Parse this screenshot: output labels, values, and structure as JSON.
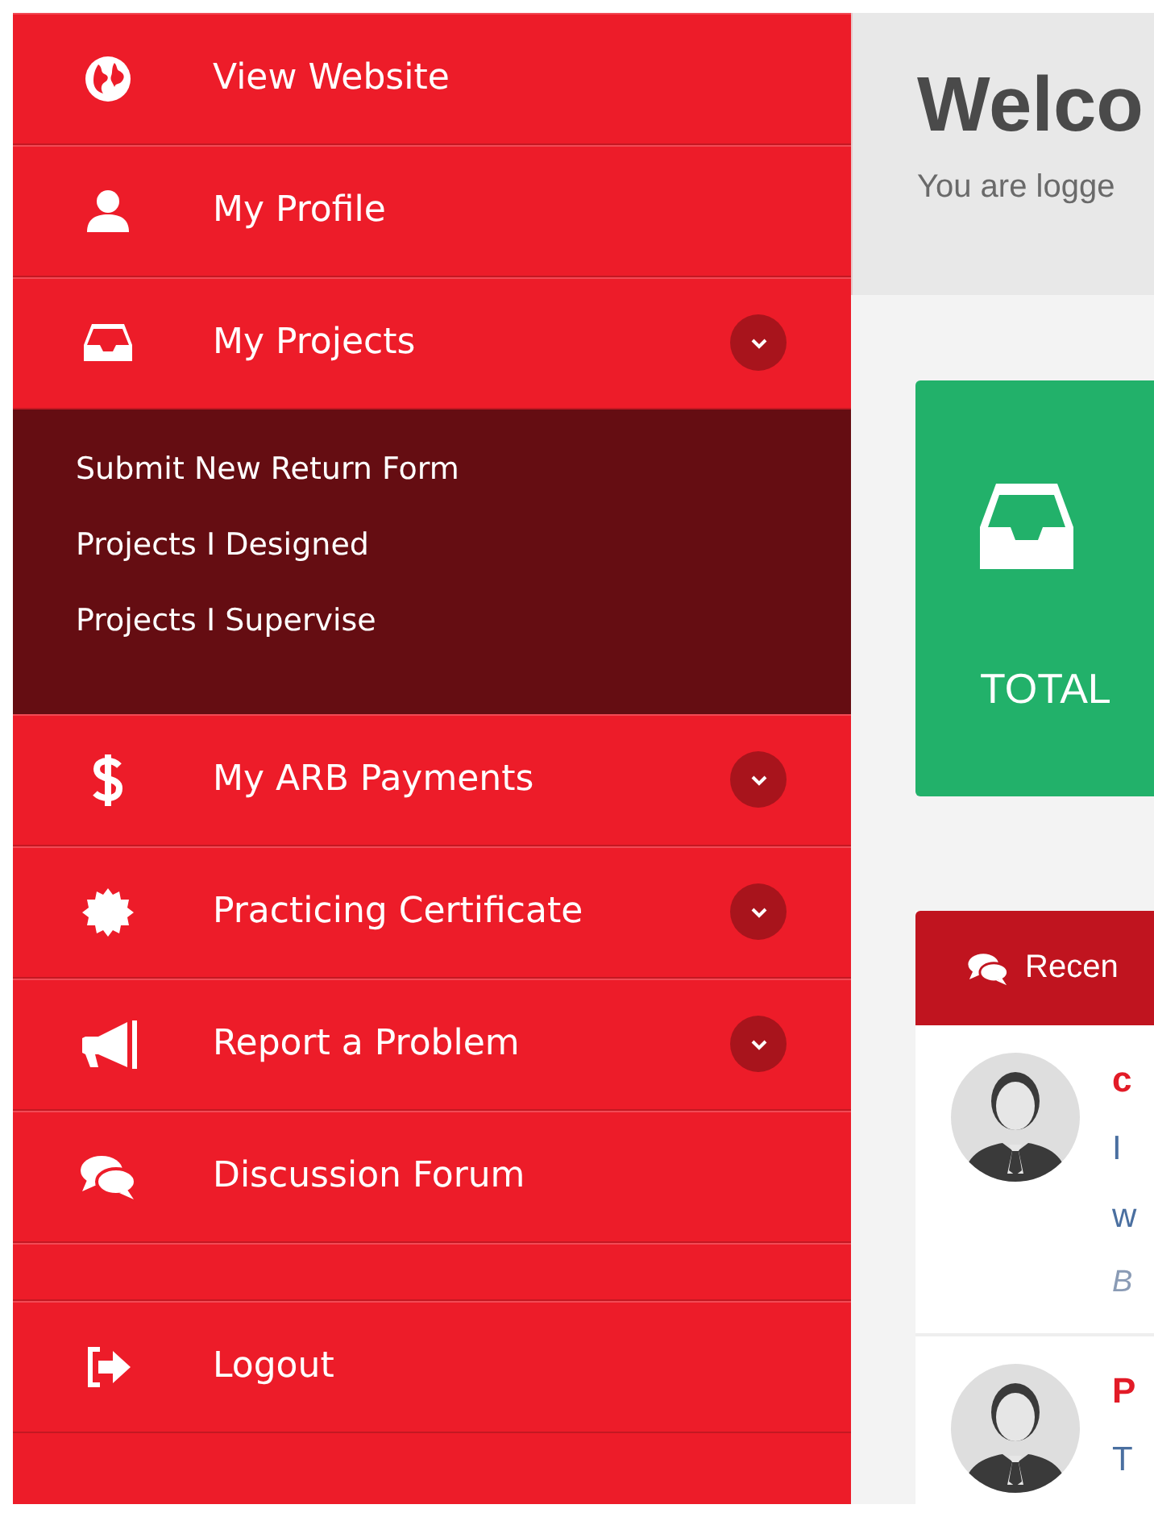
{
  "sidebar": {
    "items": [
      {
        "label": "View Website",
        "kind": "link"
      },
      {
        "label": "My Profile",
        "kind": "link"
      },
      {
        "label": "My Projects",
        "kind": "submenu",
        "children": [
          {
            "label": "Submit New Return Form"
          },
          {
            "label": "Projects I Designed"
          },
          {
            "label": "Projects I Supervise"
          }
        ]
      },
      {
        "label": "My ARB Payments",
        "kind": "submenu"
      },
      {
        "label": "Practicing Certificate",
        "kind": "submenu"
      },
      {
        "label": "Report a Problem",
        "kind": "submenu"
      },
      {
        "label": "Discussion Forum",
        "kind": "link"
      }
    ],
    "bottom_items": [
      {
        "label": "Logout",
        "kind": "link"
      }
    ]
  },
  "header": {
    "title": "Welco",
    "subtitle": "You are logge"
  },
  "stat_card": {
    "label": "TOTAL"
  },
  "recent_panel": {
    "title": "Recen",
    "entries": [
      {
        "title": "c",
        "lines": [
          "I",
          "w"
        ],
        "meta": "B"
      },
      {
        "title": "P",
        "lines": [
          "T"
        ]
      }
    ]
  }
}
